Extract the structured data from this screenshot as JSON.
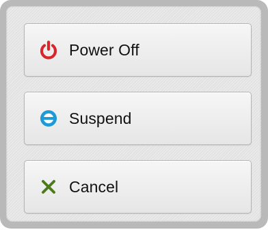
{
  "dialog": {
    "buttons": [
      {
        "label": "Power Off",
        "icon": "power-icon",
        "color": "#d8262b"
      },
      {
        "label": "Suspend",
        "icon": "suspend-icon",
        "color": "#1f9ad6"
      },
      {
        "label": "Cancel",
        "icon": "close-icon",
        "color": "#4d7b1c"
      }
    ]
  }
}
